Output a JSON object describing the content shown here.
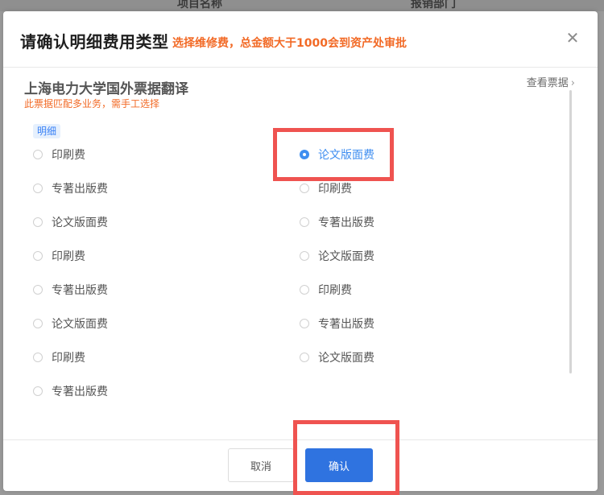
{
  "background": {
    "col1": "项目名称",
    "col2": "报销部门"
  },
  "modal": {
    "title": "请确认明细费用类型",
    "hint": "选择维修费，总金额大于1000会到资产处审批",
    "close_icon": "close-icon"
  },
  "body": {
    "section_title": "上海电力大学国外票据翻译",
    "section_subtitle": "此票据匹配多业务，需手工选择",
    "view_receipt": "查看票据",
    "detail_tag": "明细"
  },
  "options": {
    "left": [
      {
        "label": "印刷费",
        "checked": false
      },
      {
        "label": "专著出版费",
        "checked": false
      },
      {
        "label": "论文版面费",
        "checked": false
      },
      {
        "label": "印刷费",
        "checked": false
      },
      {
        "label": "专著出版费",
        "checked": false
      },
      {
        "label": "论文版面费",
        "checked": false
      },
      {
        "label": "印刷费",
        "checked": false
      },
      {
        "label": "专著出版费",
        "checked": false
      }
    ],
    "right": [
      {
        "label": "论文版面费",
        "checked": true
      },
      {
        "label": "印刷费",
        "checked": false
      },
      {
        "label": "专著出版费",
        "checked": false
      },
      {
        "label": "论文版面费",
        "checked": false
      },
      {
        "label": "印刷费",
        "checked": false
      },
      {
        "label": "专著出版费",
        "checked": false
      },
      {
        "label": "论文版面费",
        "checked": false
      }
    ]
  },
  "footer": {
    "cancel_label": "取消",
    "confirm_label": "确认"
  },
  "colors": {
    "accent": "#2f73e0",
    "hint": "#f26a26",
    "highlight": "#ef5350"
  }
}
